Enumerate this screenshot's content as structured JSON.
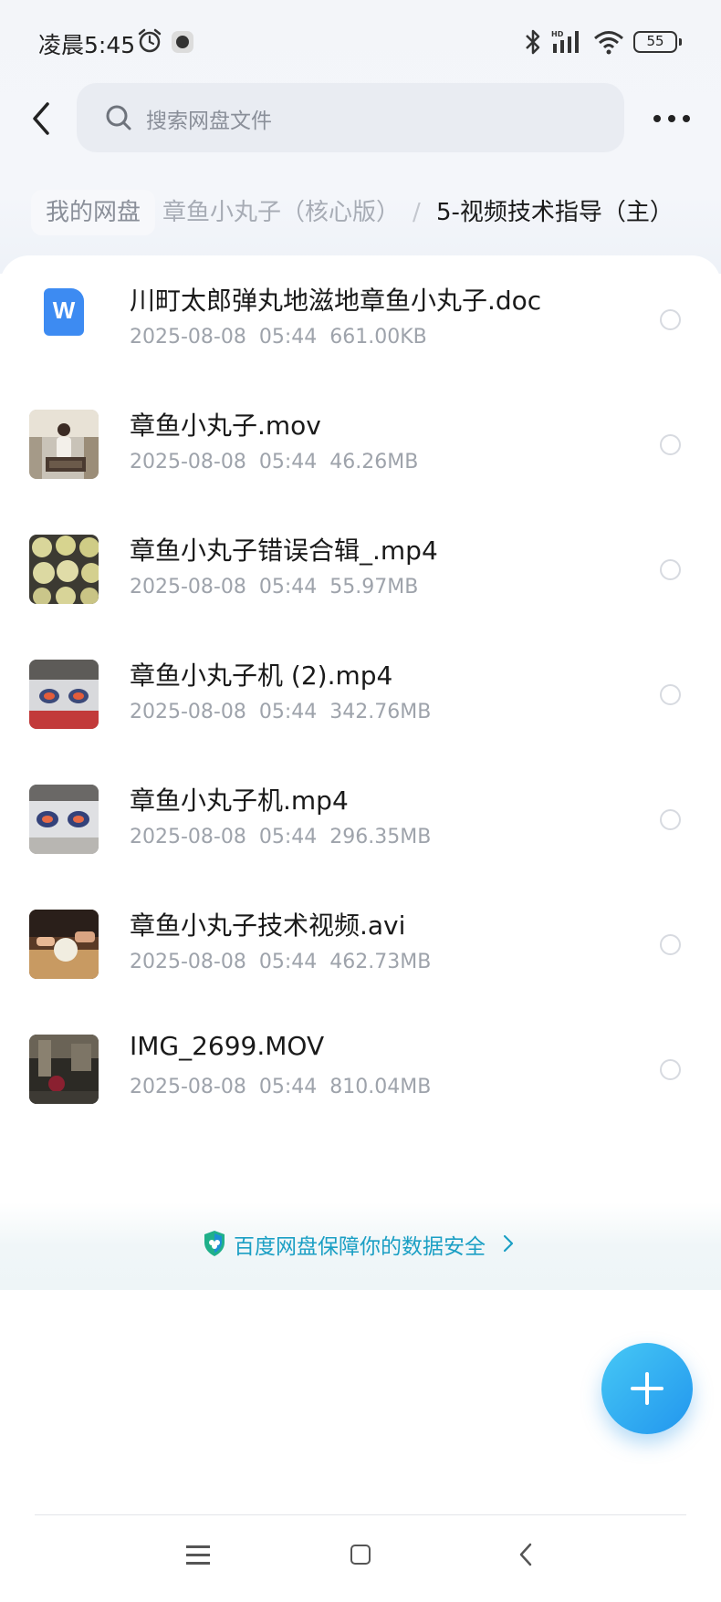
{
  "status_bar": {
    "time": "凌晨5:45",
    "battery": "55",
    "icons": [
      "alarm-icon",
      "app-dot-icon",
      "bluetooth-icon",
      "hd-signal-icon",
      "wifi-icon",
      "battery-icon"
    ]
  },
  "header": {
    "search_placeholder": "搜索网盘文件"
  },
  "breadcrumb": {
    "root": "我的网盘",
    "middle": "章鱼小丸子（核心版）",
    "separator": "/",
    "current": "5-视频技术指导（主）"
  },
  "files": [
    {
      "name": "川町太郎弹丸地滋地章鱼小丸子.doc",
      "date": "2025-08-08",
      "time": "05:44",
      "size": "661.00KB",
      "kind": "doc"
    },
    {
      "name": "章鱼小丸子.mov",
      "date": "2025-08-08",
      "time": "05:44",
      "size": "46.26MB",
      "kind": "video"
    },
    {
      "name": "章鱼小丸子错误合辑_.mp4",
      "date": "2025-08-08",
      "time": "05:44",
      "size": "55.97MB",
      "kind": "video"
    },
    {
      "name": "章鱼小丸子机 (2).mp4",
      "date": "2025-08-08",
      "time": "05:44",
      "size": "342.76MB",
      "kind": "video"
    },
    {
      "name": "章鱼小丸子机.mp4",
      "date": "2025-08-08",
      "time": "05:44",
      "size": "296.35MB",
      "kind": "video"
    },
    {
      "name": "章鱼小丸子技术视频.avi",
      "date": "2025-08-08",
      "time": "05:44",
      "size": "462.73MB",
      "kind": "video"
    },
    {
      "name": "IMG_2699.MOV",
      "date": "2025-08-08",
      "time": "05:44",
      "size": "810.04MB",
      "kind": "video"
    }
  ],
  "doc_icon_letter": "W",
  "footer": {
    "security_text": "百度网盘保障你的数据安全"
  },
  "colors": {
    "accent": "#2296ee",
    "security_text": "#1b9fc4",
    "doc_icon": "#3d8bf2"
  }
}
